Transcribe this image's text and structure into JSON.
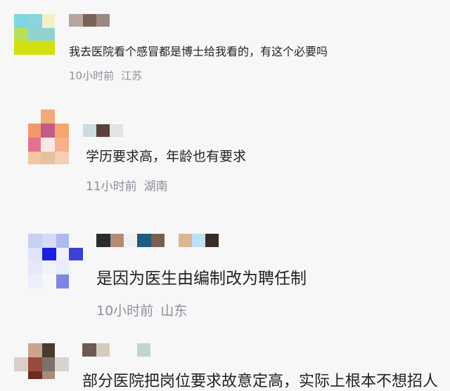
{
  "comments": [
    {
      "text": "我去医院看个感冒都是博士给我看的，有这个必要吗",
      "time": "10小时前",
      "location": "江苏"
    },
    {
      "text": "学历要求高，年龄也有要求",
      "time": "11小时前",
      "location": "湖南"
    },
    {
      "text": "是因为医生由编制改为聘任制",
      "time": "10小时前",
      "location": "山东"
    },
    {
      "text": "部分医院把岗位要求故意定高，实际上根本不想招人"
    }
  ],
  "colors": {
    "text": "#222222",
    "meta": "#8a8f99",
    "background": "#f7f7f8"
  }
}
